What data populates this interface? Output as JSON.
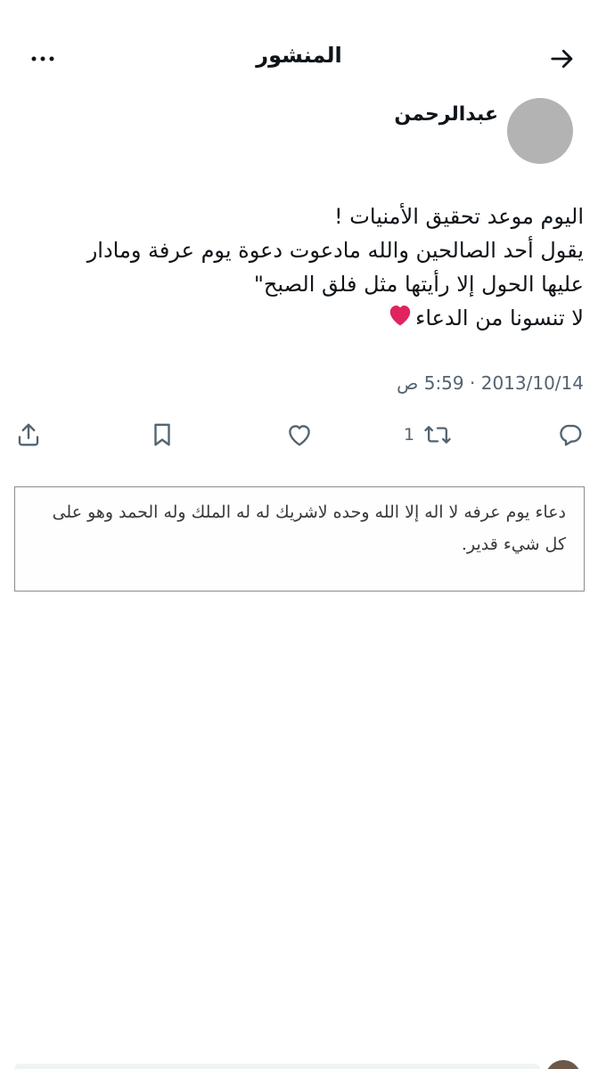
{
  "header": {
    "title": "المنشور",
    "back_icon": "arrow-right-icon",
    "more_icon": "more-horizontal-icon"
  },
  "author": {
    "name": "عبدالرحمن"
  },
  "tweet": {
    "lines": [
      "اليوم موعد تحقيق الأمنيات !",
      "يقول أحد الصالحين والله مادعوت دعوة يوم عرفة ومادار",
      "عليها الحول إلا رأيتها مثل فلق الصبح\"",
      "لا تنسونا من الدعاء"
    ],
    "emoji": "heart-emoji"
  },
  "meta": {
    "date": "2013/10/14",
    "separator": "·",
    "time": "5:59 ص"
  },
  "actions": {
    "reply_icon": "reply-icon",
    "retweet_icon": "retweet-icon",
    "retweet_count": "1",
    "like_icon": "heart-outline-icon",
    "bookmark_icon": "bookmark-icon",
    "share_icon": "share-icon"
  },
  "media": {
    "lines": [
      "دعاء يوم عرفه لا اله إلا الله وحده لاشريك له له الملك وله الحمد وهو على",
      "كل شيء قدير."
    ]
  },
  "colors": {
    "text": "#0f1419",
    "secondary": "#536471",
    "avatar": "#b3b3b3",
    "heart": "#e0245e"
  }
}
